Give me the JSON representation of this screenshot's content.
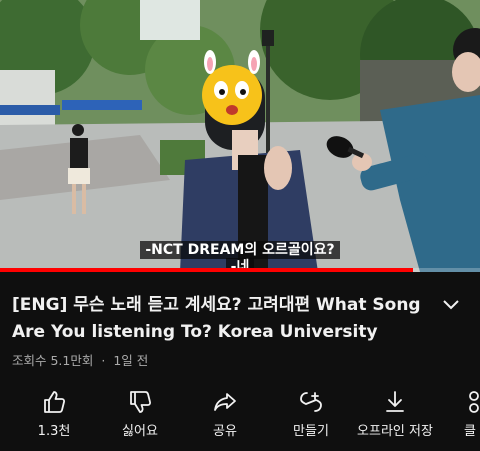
{
  "video": {
    "subtitle_line1": "-NCT DREAM의 오르골이요?",
    "subtitle_line2": "-네",
    "progress_fraction": 0.86
  },
  "title": "[ENG] 무슨 노래 듣고 계세요? 고려대편 What Song Are You listening To? Korea University",
  "meta": {
    "views": "조회수 5.1만회",
    "separator": "·",
    "age": "1일 전"
  },
  "actions": [
    {
      "icon": "thumbs-up-icon",
      "label": "1.3천"
    },
    {
      "icon": "thumbs-down-icon",
      "label": "싫어요"
    },
    {
      "icon": "share-icon",
      "label": "공유"
    },
    {
      "icon": "remix-icon",
      "label": "만들기"
    },
    {
      "icon": "download-icon",
      "label": "오프라인 저장"
    },
    {
      "icon": "clip-icon",
      "label": "클"
    }
  ],
  "colors": {
    "background": "#0f0f0f",
    "progress": "#ff0000",
    "text": "#f1f1f1",
    "meta": "#aaaaaa"
  }
}
